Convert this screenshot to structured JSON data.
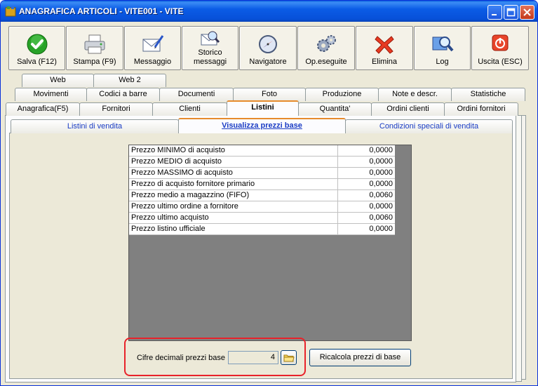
{
  "window": {
    "title": "ANAGRAFICA ARTICOLI - VITE001 - VITE"
  },
  "toolbar": [
    {
      "id": "salva",
      "label": "Salva (F12)",
      "icon": "check-icon"
    },
    {
      "id": "stampa",
      "label": "Stampa (F9)",
      "icon": "printer-icon"
    },
    {
      "id": "messaggio",
      "label": "Messaggio",
      "icon": "envelope-pen-icon"
    },
    {
      "id": "storico",
      "label": "Storico\nmessaggi",
      "icon": "envelope-search-icon"
    },
    {
      "id": "navigatore",
      "label": "Navigatore",
      "icon": "compass-icon"
    },
    {
      "id": "opeseguite",
      "label": "Op.eseguite",
      "icon": "gears-icon"
    },
    {
      "id": "elimina",
      "label": "Elimina",
      "icon": "red-x-icon"
    },
    {
      "id": "log",
      "label": "Log",
      "icon": "magnifier-icon"
    },
    {
      "id": "uscita",
      "label": "Uscita (ESC)",
      "icon": "power-icon"
    }
  ],
  "tabs": {
    "row1": [
      "Web",
      "Web 2"
    ],
    "row2": [
      "Movimenti",
      "Codici a barre",
      "Documenti",
      "Foto",
      "Produzione",
      "Note e descr.",
      "Statistiche"
    ],
    "row3": [
      "Anagrafica(F5)",
      "Fornitori",
      "Clienti",
      "Listini",
      "Quantita'",
      "Ordini clienti",
      "Ordini fornitori"
    ],
    "active": "Listini"
  },
  "subtabs": {
    "items": [
      "Listini di vendita",
      "Visualizza prezzi base",
      "Condizioni speciali di vendita"
    ],
    "active": "Visualizza prezzi base"
  },
  "prices": [
    {
      "label": "Prezzo MINIMO di acquisto",
      "value": "0,0000"
    },
    {
      "label": "Prezzo MEDIO di acquisto",
      "value": "0,0000"
    },
    {
      "label": "Prezzo MASSIMO di acquisto",
      "value": "0,0000"
    },
    {
      "label": "Prezzo di acquisto fornitore primario",
      "value": "0,0000"
    },
    {
      "label": "Prezzo medio a magazzino (FIFO)",
      "value": "0,0060"
    },
    {
      "label": "Prezzo ultimo ordine a fornitore",
      "value": "0,0000"
    },
    {
      "label": "Prezzo ultimo acquisto",
      "value": "0,0060"
    },
    {
      "label": "Prezzo listino ufficiale",
      "value": "0,0000"
    }
  ],
  "decimals": {
    "label": "Cifre decimali prezzi base :",
    "value": "4"
  },
  "recalc_label": "Ricalcola prezzi di base",
  "colors": {
    "titlebar": "#0b5ce6",
    "highlight": "#e8222a",
    "active_tab_accent": "#e68b2c",
    "subtab_text": "#1a3cc4"
  }
}
